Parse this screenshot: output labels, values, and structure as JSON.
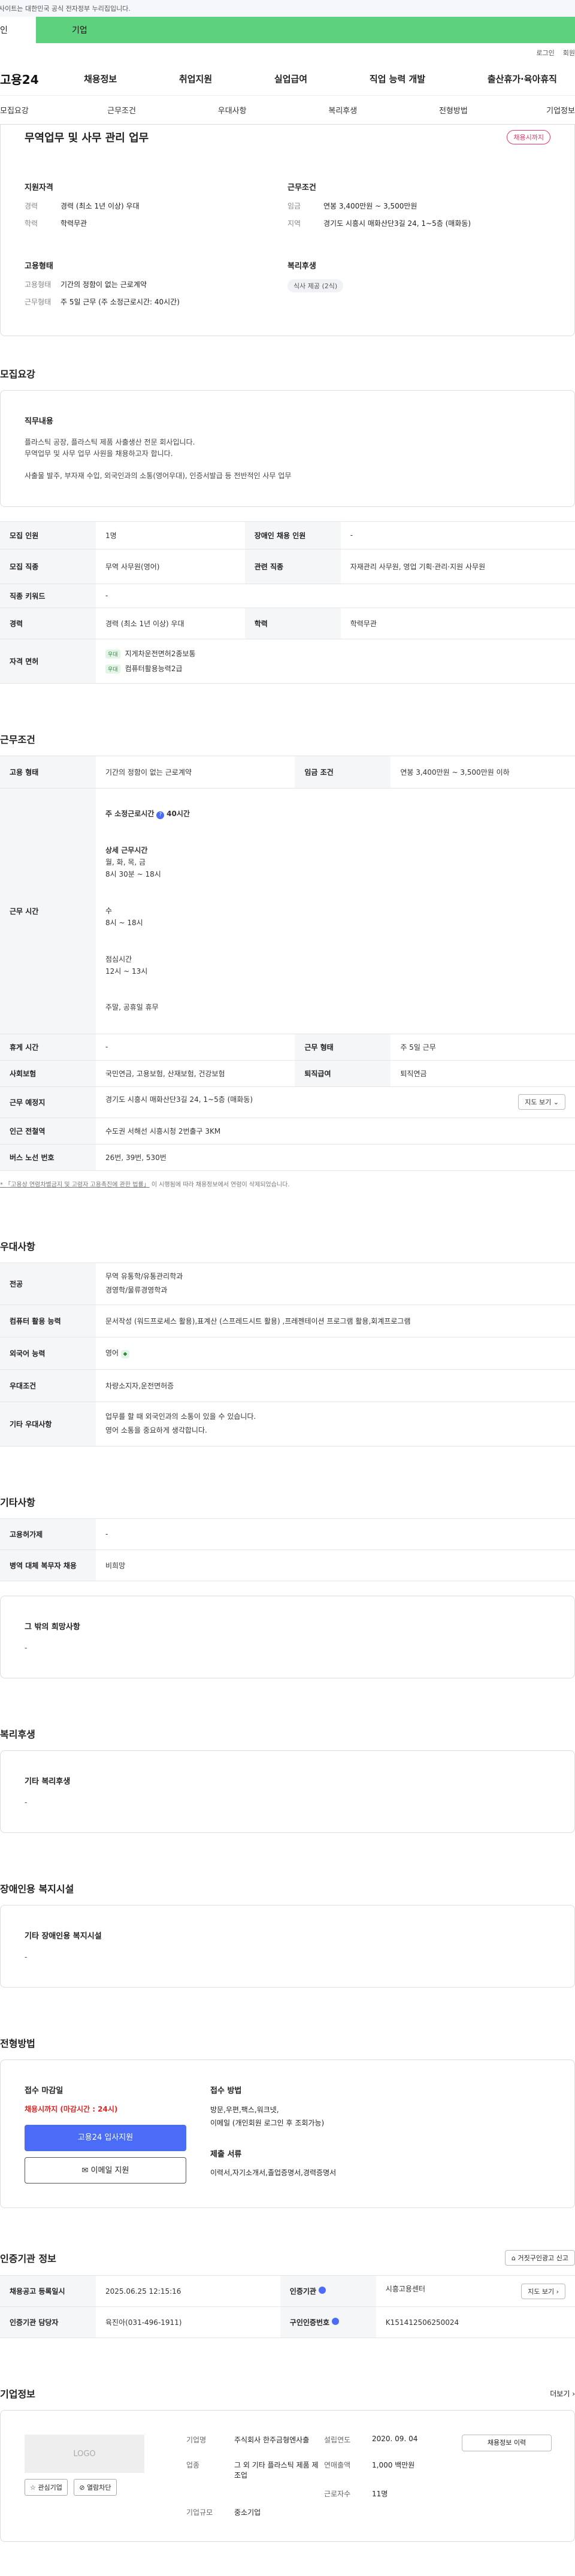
{
  "topbar": {
    "notice": "사이트는 대한민국 공식 전자정부 누리집입니다."
  },
  "tabs": {
    "a": "인",
    "b": "기업"
  },
  "util": {
    "login": "로그인",
    "signup": "회원"
  },
  "gnb": {
    "logo": "고용24",
    "menu": [
      "채용정보",
      "취업지원",
      "실업급여",
      "직업 능력 개발",
      "출산휴가·육아휴직"
    ]
  },
  "subnav": [
    "모집요강",
    "근무조건",
    "우대사항",
    "복리후생",
    "전형방법",
    "기업정보"
  ],
  "job": {
    "title": "무역업무 및 사무 관리 업무",
    "badge": "채용시까지",
    "qual_title": "지원자격",
    "qual": [
      {
        "k": "경력",
        "v": "경력 (최소 1년 이상) 우대"
      },
      {
        "k": "학력",
        "v": "학력무관"
      }
    ],
    "cond_title": "근무조건",
    "cond": [
      {
        "k": "임금",
        "v": "연봉 3,400만원 ~ 3,500만원"
      },
      {
        "k": "지역",
        "v": "경기도 시흥시 매화산단3길 24, 1~5층 (매화동)"
      }
    ],
    "emp_title": "고용형태",
    "emp": [
      {
        "k": "고용형태",
        "v": "기간의 정함이 없는 근로계약"
      },
      {
        "k": "근무형태",
        "v": "주 5일 근무 (주 소정근로시간: 40시간)"
      }
    ],
    "welfare_title": "복리후생",
    "welfare_chip": "식사 제공 (2식)"
  },
  "recruit": {
    "title": "모집요강",
    "duty_title": "직무내용",
    "duty_lines": [
      "플라스틱 공장, 플라스틱 제품 사출생산 전문 회사입니다.",
      "무역업무 및 사무 업무 사원을 채용하고자 합니다."
    ],
    "duty_line3": "사출물 발주, 부자재 수입, 외국인과의 소통(영어우대), 인증서발급 등 전반적인 사무 업무",
    "rows": [
      {
        "k1": "모집 인원",
        "v1": "1명",
        "k2": "장애인 채용 인원",
        "v2": "-"
      },
      {
        "k1": "모집 직종",
        "v1": "무역 사무원(영어)",
        "k2": "관련 직종",
        "v2": "자재관리 사무원, 영업 기획·관리·지원 사무원"
      },
      {
        "k1": "직종 키워드",
        "v1": "-"
      },
      {
        "k1": "경력",
        "v1": "경력 (최소 1년 이상) 우대",
        "k2": "학력",
        "v2": "학력무관"
      }
    ],
    "license_k": "자격 면허",
    "license_badge": "우대",
    "licenses": [
      "지게차운전면허2종보통",
      "컴퓨터활용능력2급"
    ]
  },
  "work": {
    "title": "근무조건",
    "row1": {
      "k1": "고용 형태",
      "v1": "기간의 정함이 없는 근로계약",
      "k2": "임금 조건",
      "v2": "연봉 3,400만원 ~ 3,500만원 이하"
    },
    "time_k": "근무 시간",
    "weekly": "주 소정근로시간",
    "weekly_val": "40시간",
    "detail_title": "상세 근무시간",
    "detail": [
      "월, 화, 목, 금",
      "8시 30분 ~ 18시"
    ],
    "wed": [
      "수",
      "8시 ~ 18시"
    ],
    "lunch": [
      "점심시간",
      "12시 ~ 13시"
    ],
    "holiday": "주말, 공휴일 휴무",
    "rows": [
      {
        "k1": "휴게 시간",
        "v1": "-",
        "k2": "근무 형태",
        "v2": "주 5일 근무"
      },
      {
        "k1": "사회보험",
        "v1": "국민연금, 고용보험, 산재보험, 건강보험",
        "k2": "퇴직급여",
        "v2": "퇴직연금"
      }
    ],
    "place_k": "근무 예정지",
    "place_v": "경기도 시흥시 매화산단3길 24, 1~5층 (매화동)",
    "map_btn": "지도 보기",
    "station_k": "인근 전철역",
    "station_v": "수도권 서해선 시흥시청 2번출구 3KM",
    "bus_k": "버스 노선 번호",
    "bus_v": "26번, 39번, 530번",
    "note_pre": "* 「고용상 연령차별금지 및 고령자 고용촉진에 관한 법률」",
    "note_post": " 이 시행됨에 따라 채용정보에서 연령이 삭제되었습니다."
  },
  "pref": {
    "title": "우대사항",
    "rows": [
      {
        "k": "전공",
        "v": [
          "무역 유통학/유통관리학과",
          "경영학/물류경영학과"
        ]
      },
      {
        "k": "컴퓨터 활용 능력",
        "v": [
          "문서작성 (워드프로세스 활용),표계산 (스프레드시트 활용) ,프레젠테이션 프로그램 활용,회계프로그램"
        ]
      },
      {
        "k": "외국어 능력",
        "v": [
          "영어"
        ]
      },
      {
        "k": "우대조건",
        "v": [
          "차량소지자,운전면허증"
        ]
      },
      {
        "k": "기타 우대사항",
        "v": [
          "업무를 할 때 외국인과의 소통이 있을 수 있습니다.",
          "영어 소통을 중요하게 생각합니다."
        ]
      }
    ]
  },
  "etc": {
    "title": "기타사항",
    "rows": [
      {
        "k": "고용허가제",
        "v": "-"
      },
      {
        "k": "병역 대체 복무자 채용",
        "v": "비희망"
      }
    ],
    "hope_title": "그 밖의 희망사항",
    "hope_v": "-"
  },
  "welfare": {
    "title": "복리후생",
    "box_title": "기타 복리후생",
    "box_v": "-"
  },
  "disabled": {
    "title": "장애인용 복지시설",
    "box_title": "기타 장애인용 복지시설",
    "box_v": "-"
  },
  "apply": {
    "title": "전형방법",
    "deadline_t": "접수 마감일",
    "deadline_v": "채용시까지 (마감시간 : 24시)",
    "btn1": "고용24 입사지원",
    "btn2": "이메일 지원",
    "method_t": "접수 방법",
    "method_v": [
      "방문,우편,팩스,워크넷,",
      "이메일 (개인회원 로그인 후 조회가능)"
    ],
    "docs_t": "제출 서류",
    "docs_v": "이력서,자기소개서,졸업증명서,경력증명서"
  },
  "cert": {
    "title": "인증기관 정보",
    "report_btn": "거짓구인광고 신고",
    "rows": [
      {
        "k1": "채용공고 등록일시",
        "v1": "2025.06.25 12:15:16",
        "k2": "인증기관",
        "v2": "시흥고용센터",
        "btn": "지도 보기"
      },
      {
        "k1": "인증기관 담당자",
        "v1": "육진아(031-496-1911)",
        "k2": "구인인증번호",
        "v2": "K151412506250024"
      }
    ]
  },
  "company": {
    "title": "기업정보",
    "more": "더보기",
    "logo": "LOGO",
    "fav": "관심기업",
    "block": "열람차단",
    "info_btn": "채용정보 이력",
    "grid": [
      {
        "k": "기업명",
        "v": "주식회사 한주금형엔사출"
      },
      {
        "k": "설립연도",
        "v": "2020. 09. 04"
      },
      {
        "k": "업종",
        "v": "그 외 기타 플라스틱 제품 제조업"
      },
      {
        "k": "연매출액",
        "v": "1,000 백만원"
      },
      {
        "k": "근로자수",
        "v": "11명"
      },
      {
        "k": "기업규모",
        "v": "중소기업"
      }
    ]
  }
}
